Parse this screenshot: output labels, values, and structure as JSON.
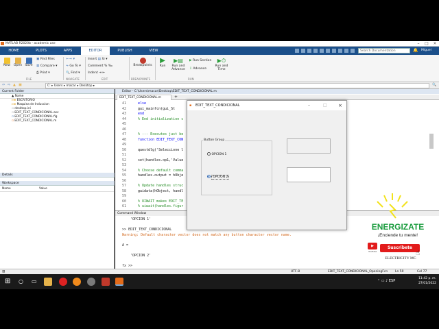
{
  "window": {
    "title": "MATLAB R2020b - academic use"
  },
  "ribbon": {
    "tabs": [
      "HOME",
      "PLOTS",
      "APPS",
      "EDITOR",
      "PUBLISH",
      "VIEW"
    ],
    "search_placeholder": "Search Documentation",
    "user": "Miguel",
    "file": {
      "new": "New",
      "open": "Open",
      "save": "Save",
      "find_files": "Find Files",
      "compare": "Compare",
      "print": "Print",
      "section": "FILE"
    },
    "navigate": {
      "go_to": "Go To",
      "find": "Find",
      "section": "NAVIGATE"
    },
    "edit": {
      "insert": "Insert",
      "comment": "Comment",
      "indent": "Indent",
      "section": "EDIT"
    },
    "breakpoints": {
      "label": "Breakpoints",
      "section": "BREAKPOINTS"
    },
    "run": {
      "run": "Run",
      "run_advance": "Run and Advance",
      "run_section": "Run Section",
      "advance": "Advance",
      "run_time": "Run and Time",
      "section": "RUN"
    }
  },
  "address": {
    "path": [
      "C:",
      "Users",
      "macar",
      "Desktop"
    ]
  },
  "current_folder": {
    "title": "Current Folder",
    "name_header": "Name",
    "items": [
      "ESCRITORIO",
      "Maquina de Induccion",
      "desktop.ini",
      "EDIT_TEXT_CONDICIONAL.asv",
      "EDIT_TEXT_CONDICIONAL.fig",
      "EDIT_TEXT_CONDICIONAL.m"
    ]
  },
  "details": {
    "title": "Details"
  },
  "workspace": {
    "title": "Workspace",
    "name_header": "Name",
    "value_header": "Value"
  },
  "editor": {
    "title": "Editor - C:\\Users\\macar\\Desktop\\EDIT_TEXT_CONDICIONAL.m",
    "tab": "EDIT_TEXT_CONDICIONAL.m",
    "lines": [
      {
        "n": "41",
        "t": "    else"
      },
      {
        "n": "42",
        "t": "        gui_mainfcn(gui_St"
      },
      {
        "n": "43",
        "t": "    end"
      },
      {
        "n": "44",
        "t": "    % End initialization c"
      },
      {
        "n": "45",
        "t": ""
      },
      {
        "n": "46",
        "t": ""
      },
      {
        "n": "47",
        "t": "    % --- Executes just be"
      },
      {
        "n": "48",
        "t": "    function EDIT_TEXT_CON"
      },
      {
        "n": "49",
        "t": ""
      },
      {
        "n": "50",
        "t": "    questdlg('Seleccione l"
      },
      {
        "n": "51",
        "t": ""
      },
      {
        "n": "52",
        "t": "    set(handles.op1,'Value"
      },
      {
        "n": "53",
        "t": ""
      },
      {
        "n": "54",
        "t": "    % Choose default comma"
      },
      {
        "n": "55",
        "t": "    handles.output = hObje"
      },
      {
        "n": "56",
        "t": ""
      },
      {
        "n": "57",
        "t": "    % Update handles struc"
      },
      {
        "n": "58",
        "t": "    guidata(hObject, handl"
      },
      {
        "n": "59",
        "t": ""
      },
      {
        "n": "60",
        "t": "    % UIWAIT makes EDIT_TE"
      },
      {
        "n": "61",
        "t": "    % uiwait(handles.figur"
      }
    ]
  },
  "command_window": {
    "title": "Command Window",
    "lines": [
      {
        "t": "    'OPCION 1'",
        "c": "#222"
      },
      {
        "t": "",
        "c": "#222"
      },
      {
        "t": ">> EDIT_TEXT_CONDICIONAL",
        "c": "#222"
      },
      {
        "t": "Warning: Default character vector does not match any button character vector name.",
        "c": "#d2691e"
      },
      {
        "t": "",
        "c": "#222"
      },
      {
        "t": "A =",
        "c": "#222"
      },
      {
        "t": "",
        "c": "#222"
      },
      {
        "t": "    'OPCION 2'",
        "c": "#222"
      },
      {
        "t": "",
        "c": "#222"
      },
      {
        "t": "fx >>",
        "c": "#222"
      }
    ]
  },
  "statusbar": {
    "encoding": "UTF-8",
    "function": "EDIT_TEXT_CONDICIONAL_OpeningFcn",
    "ln": "Ln 50",
    "col": "Col 77"
  },
  "figure": {
    "title": "EDIT_TEXT_CONDICIONAL",
    "button_group": "Button Group",
    "option1": "OPCION 1",
    "option2": "OPCION 2"
  },
  "taskbar": {
    "time": "11:42 p. m.",
    "date": "27/01/2022"
  },
  "ad": {
    "title": "ENERGIZATE",
    "subtitle": "¡Enciende tu mente!",
    "subscribe": "Suscribete",
    "youtube": "YouTube",
    "brand": "ELECTRICITY MC"
  },
  "colors": {
    "ribbon_tab": "#1b4f8a",
    "ad_green": "#1a9c3e",
    "youtube_red": "#e21b1b",
    "warning": "#d2691e"
  }
}
